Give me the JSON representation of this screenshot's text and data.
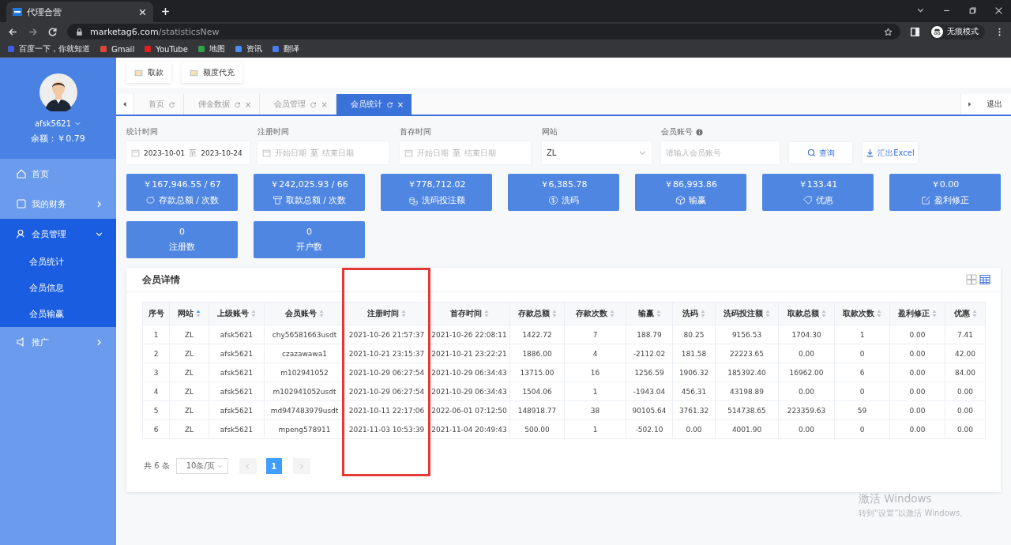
{
  "browser": {
    "tab_title": "代理合营",
    "url_host": "marketag6.com",
    "url_path": "/statisticsNew",
    "incognito_label": "无痕模式",
    "bookmarks": [
      "百度一下，你就知道",
      "Gmail",
      "YouTube",
      "地图",
      "资讯",
      "翻译"
    ]
  },
  "user": {
    "name": "afsk5621",
    "balance": "余额：￥0.79"
  },
  "sidebar": {
    "items": [
      {
        "label": "首页"
      },
      {
        "label": "我的财务",
        "expanded": false
      },
      {
        "label": "会员管理",
        "expanded": true,
        "children": [
          {
            "label": "会员统计"
          },
          {
            "label": "会员信息"
          },
          {
            "label": "会员输赢"
          }
        ]
      },
      {
        "label": "推广",
        "expanded": false
      }
    ]
  },
  "toolbar": [
    "取款",
    "额度代充"
  ],
  "tabs": [
    {
      "label": "首页",
      "selected": false,
      "closable": false
    },
    {
      "label": "佣金数据",
      "selected": false,
      "closable": true
    },
    {
      "label": "会员管理",
      "selected": false,
      "closable": true
    },
    {
      "label": "会员统计",
      "selected": true,
      "closable": true
    }
  ],
  "tab_close": "×",
  "logout": "退出",
  "filters": [
    {
      "kind": "daterange",
      "label": "统计时间",
      "start": "2023-10-01",
      "end": "2023-10-24",
      "separator": "至"
    },
    {
      "kind": "daterange",
      "label": "注册时间",
      "start_placeholder": "开始日期",
      "end_placeholder": "结束日期",
      "separator": "至"
    },
    {
      "kind": "daterange",
      "label": "首存时间",
      "start_placeholder": "开始日期",
      "end_placeholder": "结束日期",
      "separator": "至"
    },
    {
      "kind": "select",
      "label": "网站",
      "value": "ZL"
    },
    {
      "kind": "text",
      "label": "会员账号",
      "placeholder": "请输入会员账号",
      "info": true
    }
  ],
  "actions": [
    "查询",
    "汇出Excel"
  ],
  "stats": [
    {
      "value": "￥167,946.55 / 67",
      "label": "存款总额 / 次数"
    },
    {
      "value": "￥242,025.93 / 66",
      "label": "取款总额 / 次数"
    },
    {
      "value": "￥778,712.02",
      "label": "洗码投注额"
    },
    {
      "value": "￥6,385.78",
      "label": "洗码"
    },
    {
      "value": "￥86,993.86",
      "label": "输赢"
    },
    {
      "value": "￥133.41",
      "label": "优惠"
    },
    {
      "value": "￥0.00",
      "label": "盈利修正"
    },
    {
      "value": "0",
      "label": "注册数"
    },
    {
      "value": "0",
      "label": "开户数"
    }
  ],
  "details": {
    "title": "会员详情",
    "columns": [
      {
        "label": "序号",
        "sortable": false,
        "highlighted": false
      },
      {
        "label": "网站",
        "sortable": true,
        "sorted": true,
        "highlighted": false
      },
      {
        "label": "上级账号",
        "sortable": true,
        "sorted": false,
        "highlighted": false
      },
      {
        "label": "会员账号",
        "sortable": true,
        "sorted": false,
        "highlighted": false
      },
      {
        "label": "注册时间",
        "sortable": true,
        "sorted": false,
        "highlighted": true
      },
      {
        "label": "首存时间",
        "sortable": true,
        "sorted": false,
        "highlighted": false
      },
      {
        "label": "存款总额",
        "sortable": true,
        "sorted": false,
        "highlighted": false
      },
      {
        "label": "存款次数",
        "sortable": true,
        "sorted": false,
        "highlighted": false
      },
      {
        "label": "输赢",
        "sortable": true,
        "sorted": false,
        "highlighted": false
      },
      {
        "label": "洗码",
        "sortable": true,
        "sorted": false,
        "highlighted": false
      },
      {
        "label": "洗码投注额",
        "sortable": true,
        "sorted": false,
        "highlighted": false
      },
      {
        "label": "取款总额",
        "sortable": true,
        "sorted": false,
        "highlighted": false
      },
      {
        "label": "取款次数",
        "sortable": true,
        "sorted": false,
        "highlighted": false
      },
      {
        "label": "盈利修正",
        "sortable": true,
        "sorted": false,
        "highlighted": false
      },
      {
        "label": "优惠",
        "sortable": true,
        "sorted": false,
        "highlighted": false
      }
    ],
    "rows": [
      [
        "1",
        "ZL",
        "afsk5621",
        "chy56581663usdt",
        "2021-10-26 21:57:37",
        "2021-10-26 22:08:11",
        "1422.72",
        "7",
        "188.79",
        "80.25",
        "9156.53",
        "1704.30",
        "1",
        "0.00",
        "7.41"
      ],
      [
        "2",
        "ZL",
        "afsk5621",
        "czazawawa1",
        "2021-10-21 23:15:37",
        "2021-10-21 23:22:21",
        "1886.00",
        "4",
        "-2112.02",
        "181.58",
        "22223.65",
        "0.00",
        "0",
        "0.00",
        "42.00"
      ],
      [
        "3",
        "ZL",
        "afsk5621",
        "m102941052",
        "2021-10-29 06:27:54",
        "2021-10-29 06:34:43",
        "13715.00",
        "16",
        "1256.59",
        "1906.32",
        "185392.40",
        "16962.00",
        "6",
        "0.00",
        "84.00"
      ],
      [
        "4",
        "ZL",
        "afsk5621",
        "m102941052usdt",
        "2021-10-29 06:27:54",
        "2021-10-29 06:34:43",
        "1504.06",
        "1",
        "-1943.04",
        "456.31",
        "43198.89",
        "0.00",
        "0",
        "0.00",
        "0.00"
      ],
      [
        "5",
        "ZL",
        "afsk5621",
        "md947483979usdt",
        "2021-10-11 22:17:06",
        "2022-06-01 07:12:50",
        "148918.77",
        "38",
        "90105.64",
        "3761.32",
        "514738.65",
        "223359.63",
        "59",
        "0.00",
        "0.00"
      ],
      [
        "6",
        "ZL",
        "afsk5621",
        "mpeng578911",
        "2021-11-03 10:53:39",
        "2021-11-04 20:49:43",
        "500.00",
        "1",
        "-502.10",
        "0.00",
        "4001.90",
        "0.00",
        "0",
        "0.00",
        "0.00"
      ]
    ],
    "view_toggle": [
      {
        "selected": false
      },
      {
        "selected": true
      }
    ],
    "pagination": {
      "total": "共 6 条",
      "page_size": "10条/页",
      "pages": [
        {
          "label": "1",
          "selected": true
        }
      ]
    }
  },
  "os_watermark": [
    "激活 Windows",
    "转到“设置”以激活 Windows。"
  ]
}
